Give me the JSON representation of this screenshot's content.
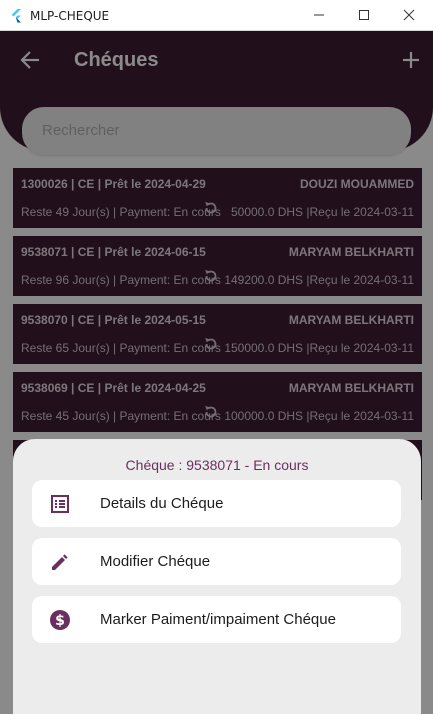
{
  "window": {
    "title": "MLP-CHEQUE"
  },
  "header": {
    "title": "Chéques"
  },
  "search": {
    "placeholder": "Rechercher"
  },
  "cheques": [
    {
      "title": "1300026 | CE | Prêt le 2024-04-29",
      "name": "DOUZI MOUAMMED",
      "status": "Reste 49 Jour(s) | Payment: En cours",
      "amount": "50000.0 DHS |Reçu le 2024-03-11"
    },
    {
      "title": "9538071 | CE | Prêt le 2024-06-15",
      "name": "MARYAM BELKHARTI",
      "status": "Reste 96 Jour(s) | Payment: En cours",
      "amount": "149200.0 DHS |Reçu le 2024-03-11"
    },
    {
      "title": "9538070 | CE | Prêt le 2024-05-15",
      "name": "MARYAM BELKHARTI",
      "status": "Reste 65 Jour(s) | Payment: En cours",
      "amount": "150000.0 DHS |Reçu le 2024-03-11"
    },
    {
      "title": "9538069 | CE | Prêt le 2024-04-25",
      "name": "MARYAM BELKHARTI",
      "status": "Reste 45 Jour(s) | Payment: En cours",
      "amount": "100000.0 DHS |Reçu le 2024-03-11"
    }
  ],
  "sheet": {
    "title": "Chéque : 9538071 - En cours",
    "options": [
      {
        "label": "Details du Chéque",
        "icon": "list-details-icon"
      },
      {
        "label": "Modifier Chéque",
        "icon": "pencil-icon"
      },
      {
        "label": "Marker Paiment/impaiment Chéque",
        "icon": "dollar-circle-icon"
      }
    ]
  },
  "colors": {
    "primary": "#3d1c35",
    "accent": "#6b2f5f",
    "sheet": "#ececec"
  }
}
